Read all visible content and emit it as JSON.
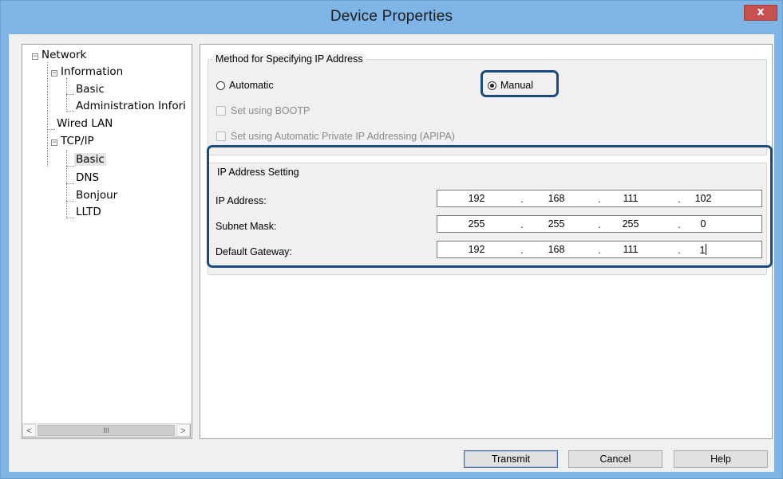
{
  "window": {
    "title": "Device Properties",
    "close_label": "x"
  },
  "tree": {
    "items": [
      {
        "label": "Network",
        "level": 0,
        "expander": "−"
      },
      {
        "label": "Information",
        "level": 1,
        "expander": "−"
      },
      {
        "label": "Basic",
        "level": 2
      },
      {
        "label": "Administration Infori",
        "level": 2
      },
      {
        "label": "Wired LAN",
        "level": 1
      },
      {
        "label": "TCP/IP",
        "level": 1,
        "expander": "−"
      },
      {
        "label": "Basic",
        "level": 2,
        "selected": true
      },
      {
        "label": "DNS",
        "level": 2
      },
      {
        "label": "Bonjour",
        "level": 2
      },
      {
        "label": "LLTD",
        "level": 2
      }
    ],
    "scroll_left": "<",
    "scroll_thumb": "III",
    "scroll_right": ">"
  },
  "method": {
    "title": "Method for Specifying IP Address",
    "automatic_label": "Automatic",
    "manual_label": "Manual",
    "selected": "manual",
    "bootp_label": "Set using BOOTP",
    "apipa_label": "Set using Automatic Private IP Addressing (APIPA)"
  },
  "ip_setting": {
    "title": "IP Address Setting",
    "fields": [
      {
        "label": "IP Address:",
        "octets": [
          "192",
          "168",
          "111",
          "102"
        ]
      },
      {
        "label": "Subnet Mask:",
        "octets": [
          "255",
          "255",
          "255",
          "0"
        ]
      },
      {
        "label": "Default Gateway:",
        "octets": [
          "192",
          "168",
          "111",
          "1"
        ]
      }
    ],
    "separator": "."
  },
  "buttons": {
    "transmit": "Transmit",
    "cancel": "Cancel",
    "help": "Help"
  },
  "colors": {
    "titlebar": "#7fb4e6",
    "highlight": "#1b4b7e",
    "close": "#c75050"
  }
}
